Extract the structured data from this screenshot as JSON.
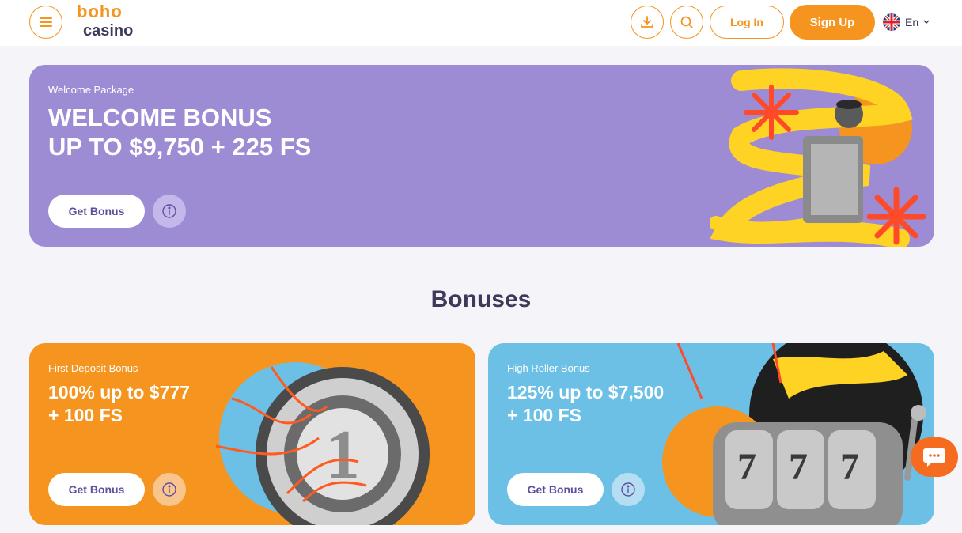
{
  "header": {
    "logo_top": "boho",
    "logo_bottom": "casino",
    "login_label": "Log In",
    "signup_label": "Sign Up",
    "language": "En"
  },
  "hero": {
    "eyebrow": "Welcome Package",
    "title_line1": "WELCOME BONUS",
    "title_line2": "UP TO $9,750 + 225 FS",
    "button_label": "Get Bonus",
    "bg_color": "#9d8bd4"
  },
  "section": {
    "title": "Bonuses"
  },
  "cards": [
    {
      "eyebrow": "First Deposit Bonus",
      "title_line1": "100% up to $777",
      "title_line2": "+ 100 FS",
      "button_label": "Get Bonus",
      "bg_color": "#f5941f"
    },
    {
      "eyebrow": "High Roller Bonus",
      "title_line1": "125% up to $7,500",
      "title_line2": "+ 100 FS",
      "button_label": "Get Bonus",
      "bg_color": "#6cc0e5"
    }
  ],
  "colors": {
    "accent": "#f5941f",
    "text_dark": "#3d3a5c",
    "chat": "#f56b1f"
  },
  "icons": [
    "menu-icon",
    "download-icon",
    "search-icon",
    "uk-flag-icon",
    "chevron-down-icon",
    "info-icon",
    "chat-icon"
  ]
}
